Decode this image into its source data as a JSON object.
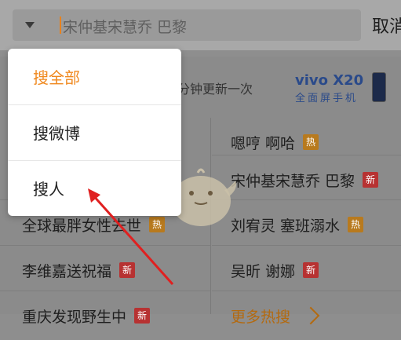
{
  "search": {
    "query": "宋仲基宋慧乔 巴黎",
    "cancel_label": "取消"
  },
  "dropdown": {
    "items": [
      {
        "label": "搜全部",
        "active": true
      },
      {
        "label": "搜微博",
        "active": false
      },
      {
        "label": "搜人",
        "active": false
      }
    ]
  },
  "refresh": {
    "text": "分钟更新一次"
  },
  "ad": {
    "brand": "vivo X20",
    "tagline": "全面屏手机"
  },
  "hot": {
    "left": [
      {
        "text": "全球最胖女性去世",
        "badge": "热"
      },
      {
        "text": "李维嘉送祝福",
        "badge": "新"
      },
      {
        "text": "重庆发现野生中",
        "badge": "新"
      }
    ],
    "right": [
      {
        "text": "嗯哼 啊哈",
        "badge": "热"
      },
      {
        "text": "宋仲基宋慧乔 巴黎",
        "badge": "新"
      },
      {
        "text": "刘宥灵 塞班溺水",
        "badge": "热"
      },
      {
        "text": "吴昕 谢娜",
        "badge": "新"
      },
      {
        "text": "更多热搜",
        "badge": ""
      }
    ]
  },
  "colors": {
    "accent": "#f0891f",
    "hot_badge": "#b87a1e",
    "new_badge": "#b73232",
    "annotation": "#e02020"
  }
}
